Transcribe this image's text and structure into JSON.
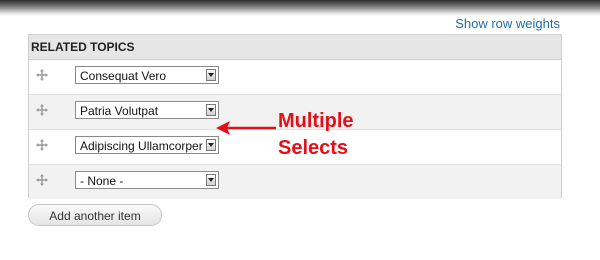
{
  "header": {
    "show_row_weights": "Show row weights"
  },
  "related_topics": {
    "title": "RELATED TOPICS",
    "rows": [
      {
        "selected": "Consequat Vero"
      },
      {
        "selected": "Patria Volutpat"
      },
      {
        "selected": "Adipiscing Ullamcorper"
      },
      {
        "selected": "- None -"
      }
    ]
  },
  "actions": {
    "add_another_item": "Add another item"
  },
  "annotation": {
    "line1": "Multiple",
    "line2": "Selects",
    "color": "#e3101a"
  },
  "icons": {
    "drag_handle": "drag-handle-icon",
    "dropdown_arrow": "chevron-down-icon",
    "callout": "arrow-left-icon"
  }
}
